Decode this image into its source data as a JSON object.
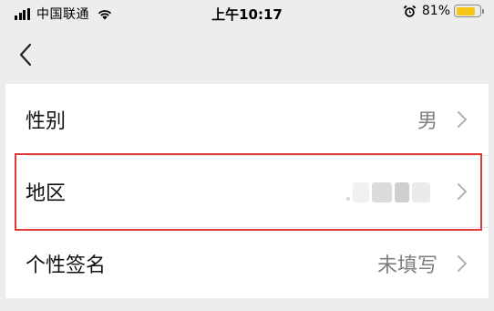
{
  "status_bar": {
    "carrier": "中国联通",
    "time": "上午10:17",
    "battery_percent": "81%",
    "battery_level": 0.81,
    "icons": [
      "signal-icon",
      "wifi-icon",
      "alarm-icon",
      "battery-icon"
    ]
  },
  "nav": {
    "back_icon": "chevron-left-icon"
  },
  "rows": [
    {
      "label": "性别",
      "value": "男"
    },
    {
      "label": "地区",
      "value": ""
    },
    {
      "label": "个性签名",
      "value": "未填写"
    }
  ],
  "colors": {
    "highlight": "#e13a3a",
    "battery": "#f5c518",
    "background": "#ededed"
  }
}
